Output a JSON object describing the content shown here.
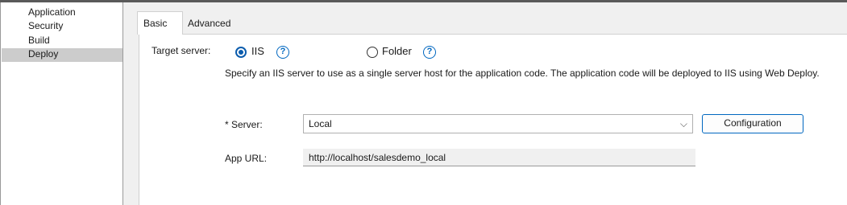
{
  "sidebar": {
    "items": [
      {
        "label": "Application"
      },
      {
        "label": "Security"
      },
      {
        "label": "Build"
      },
      {
        "label": "Deploy"
      }
    ],
    "selected": "Deploy"
  },
  "tabs": [
    {
      "label": "Basic",
      "active": true
    },
    {
      "label": "Advanced",
      "active": false
    }
  ],
  "form": {
    "target_label": "Target server:",
    "option_iis": "IIS",
    "option_folder": "Folder",
    "selected_option": "IIS",
    "help_glyph": "?",
    "description": "Specify an IIS server to use as a single server host for the application code. The application code will be deployed to IIS using Web Deploy.",
    "server_label": "* Server:",
    "server_value": "Local",
    "dropdown_glyph": "⌵",
    "configuration_label": "Configuration",
    "app_url_label": "App URL:",
    "app_url_value": "http://localhost/salesdemo_local"
  },
  "colors": {
    "accent": "#0067c0",
    "selected_item_bg": "#cccccc"
  }
}
